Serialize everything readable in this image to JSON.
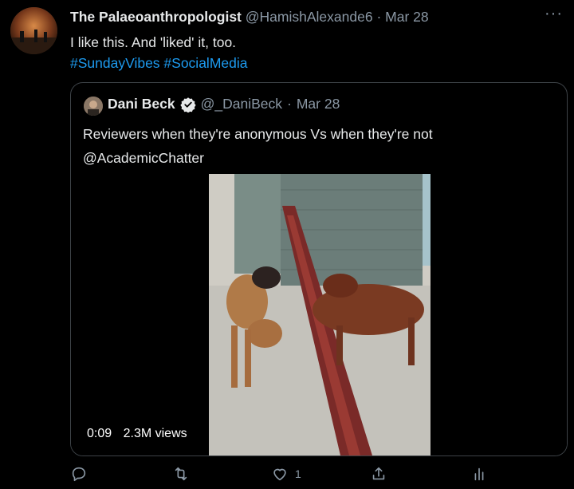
{
  "tweet": {
    "author_name": "The Palaeoanthropologist",
    "author_handle": "@HamishAlexande6",
    "separator": "·",
    "date": "Mar 28",
    "more_label": "···",
    "text": "I like this. And 'liked' it, too.",
    "hashtags": [
      "#SundayVibes",
      "#SocialMedia"
    ]
  },
  "quote": {
    "author_name": "Dani Beck",
    "author_handle": "@_DaniBeck",
    "separator": "·",
    "date": "Mar 28",
    "text_line1": "Reviewers when they're anonymous Vs when they're not",
    "text_line2": "@AcademicChatter",
    "video": {
      "duration": "0:09",
      "views": "2.3M views"
    }
  },
  "actions": {
    "reply_icon": "reply-icon",
    "retweet_icon": "retweet-icon",
    "like_icon": "like-icon",
    "like_count": "1",
    "share_icon": "share-icon",
    "analytics_icon": "analytics-icon"
  },
  "colors": {
    "background": "#000000",
    "link": "#1d9bf0",
    "muted": "#8b98a5",
    "verified": "#e7e9ea"
  }
}
